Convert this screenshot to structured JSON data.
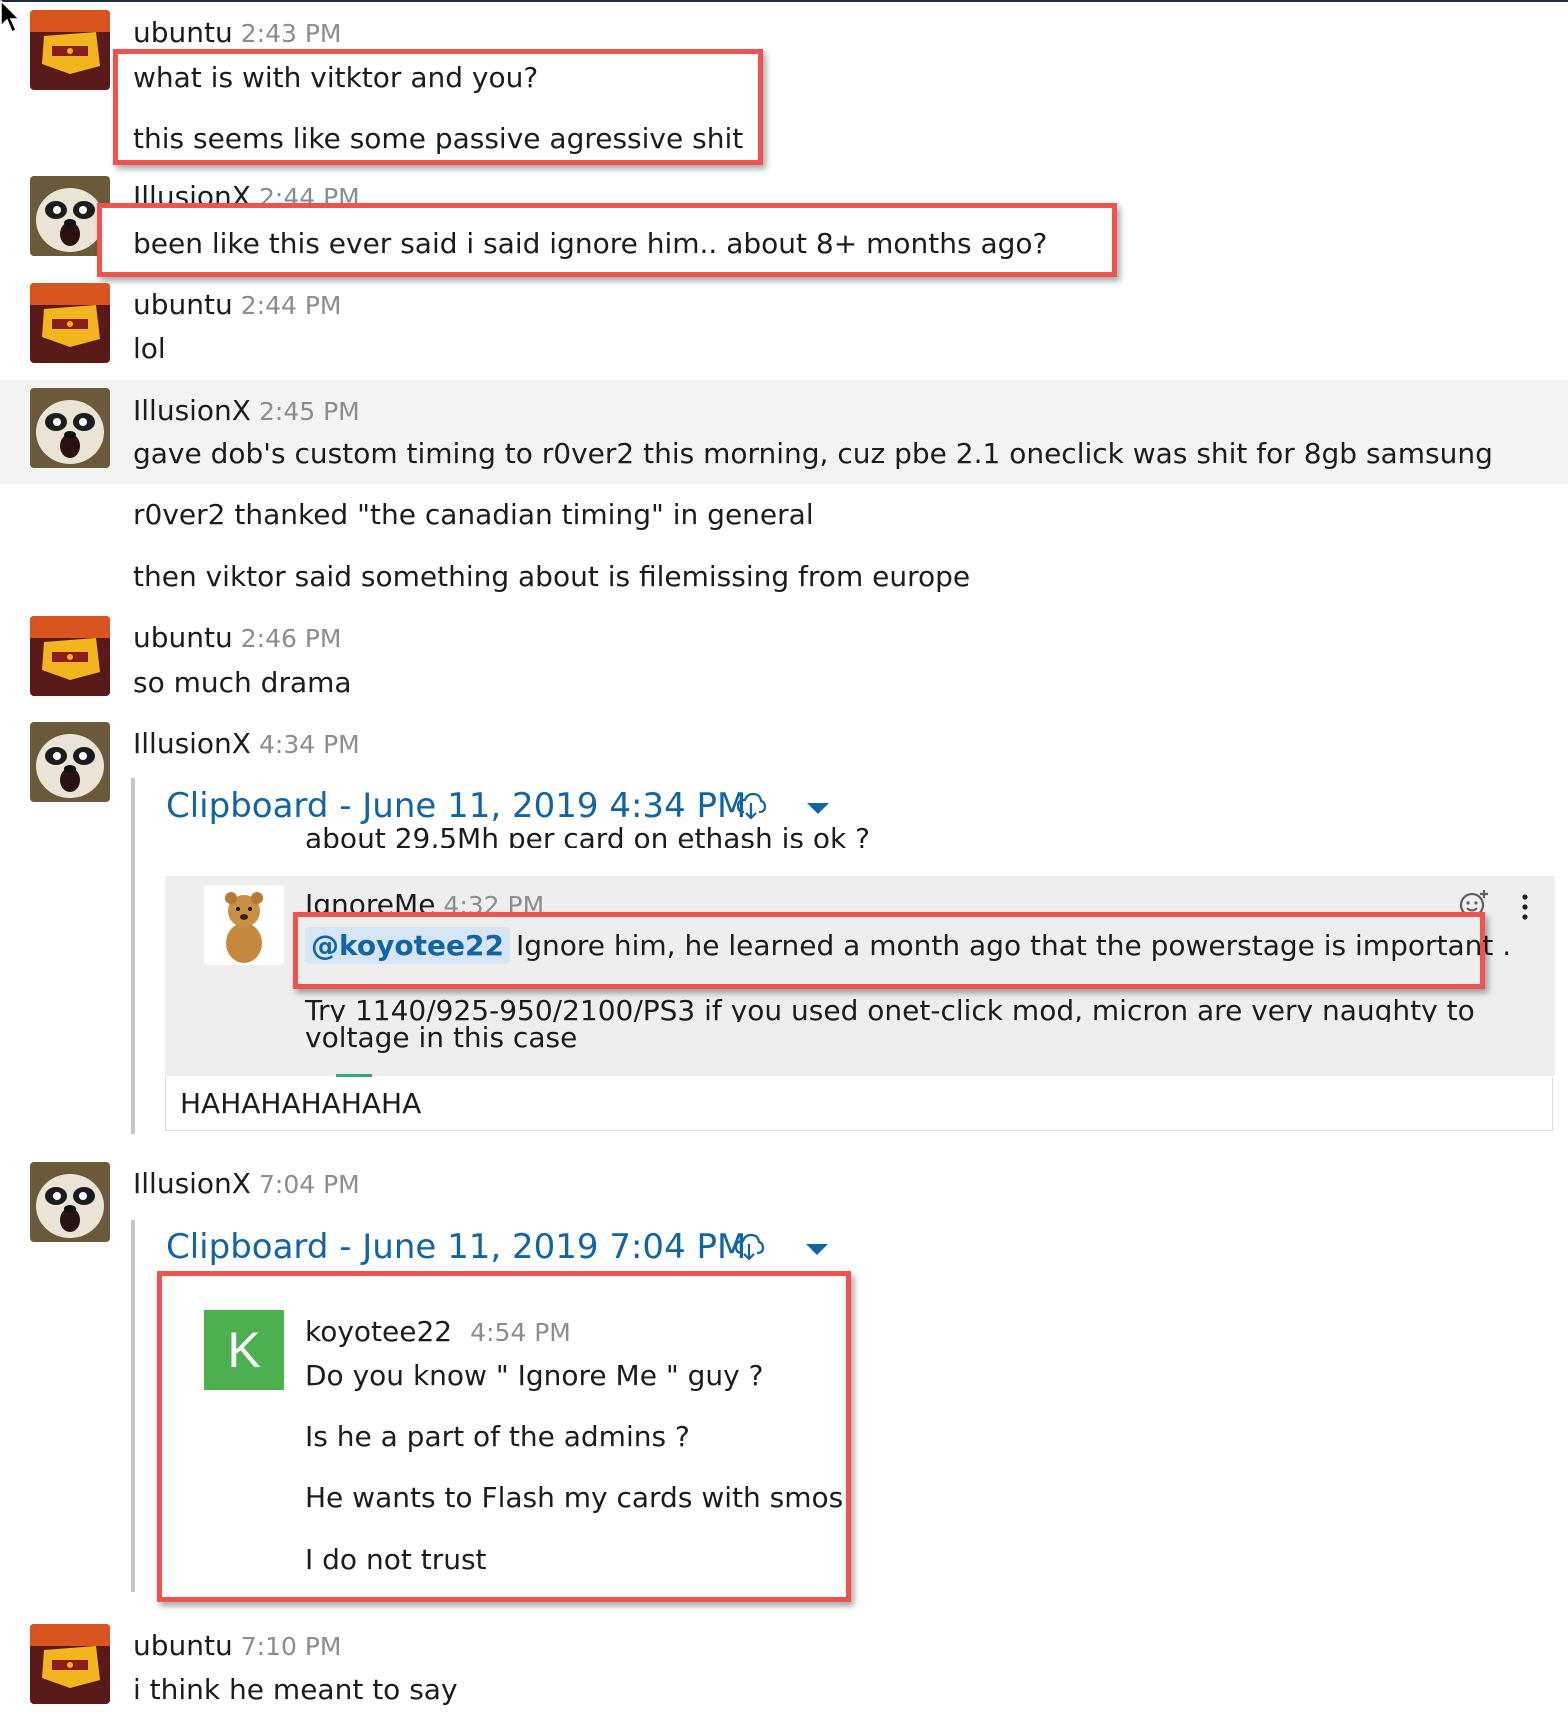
{
  "messages": [
    {
      "user": "ubuntu",
      "time": "2:43 PM",
      "lines": [
        "what is with vitktor and you?",
        "this seems like some passive agressive shit"
      ]
    },
    {
      "user": "IllusionX",
      "time": "2:44 PM",
      "lines": [
        "been like this ever said i said ignore him.. about 8+ months ago?"
      ]
    },
    {
      "user": "ubuntu",
      "time": "2:44 PM",
      "lines": [
        "lol"
      ]
    },
    {
      "user": "IllusionX",
      "time": "2:45 PM",
      "lines": [
        "gave dob's custom timing to r0ver2 this morning, cuz pbe 2.1 oneclick was shit for 8gb samsung",
        "r0ver2 thanked \"the canadian timing\" in general",
        "then viktor said something about is filemissing from europe"
      ]
    },
    {
      "user": "ubuntu",
      "time": "2:46 PM",
      "lines": [
        "so much drama"
      ]
    },
    {
      "user": "IllusionX",
      "time": "4:34 PM",
      "lines": []
    },
    {
      "user": "IllusionX",
      "time": "7:04 PM",
      "lines": []
    },
    {
      "user": "ubuntu",
      "time": "7:10 PM",
      "lines": [
        "i think he meant to say"
      ]
    }
  ],
  "clip1": {
    "title": "Clipboard - June 11, 2019 4:34 PM",
    "partial_line": "about 29,5Mh per card on ethash is ok ?",
    "inner_user": "IgnoreMe",
    "inner_time": "4:32 PM",
    "mention": "@koyotee22",
    "line1": "Ignore him, he learned a month ago that the powerstage is important .",
    "line2": "Try 1140/925-950/2100/PS3 if you used onet-click mod, micron are very naughty to",
    "line3": "voltage in this case",
    "reply": "HAHAHAHAHAHA"
  },
  "clip2": {
    "title": "Clipboard - June 11, 2019 7:04 PM",
    "inner_user": "koyotee22",
    "inner_time": "4:54 PM",
    "avatar_letter": "K",
    "lines": [
      "Do you know \" Ignore Me \" guy ?",
      "Is he a part of the admins ?",
      "He wants to Flash my cards with smos",
      "I do not trust"
    ]
  },
  "colors": {
    "annotation_red": "#ef5350",
    "link_blue": "#1264a3",
    "k_avatar_green": "#4caf50"
  },
  "icons": [
    "cursor-arrow-icon",
    "cloud-download-icon",
    "caret-down-icon",
    "add-reaction-icon",
    "more-vertical-icon"
  ]
}
